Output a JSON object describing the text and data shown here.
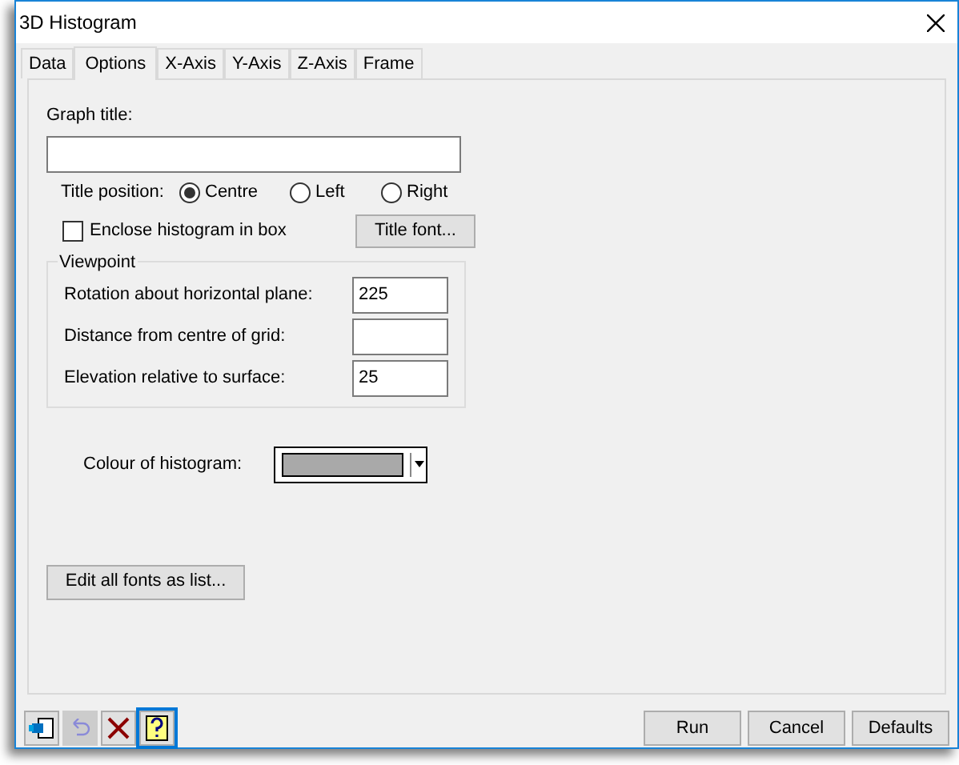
{
  "window": {
    "title": "3D Histogram"
  },
  "tabs": [
    {
      "label": "Data",
      "selected": false
    },
    {
      "label": "Options",
      "selected": true
    },
    {
      "label": "X-Axis",
      "selected": false
    },
    {
      "label": "Y-Axis",
      "selected": false
    },
    {
      "label": "Z-Axis",
      "selected": false
    },
    {
      "label": "Frame",
      "selected": false
    }
  ],
  "graph_title": {
    "label": "Graph title:"
  },
  "title_position": {
    "label": "Title position:",
    "options": [
      {
        "label": "Centre",
        "selected": true
      },
      {
        "label": "Left",
        "selected": false
      },
      {
        "label": "Right",
        "selected": false
      }
    ]
  },
  "enclose_checkbox": {
    "label": "Enclose histogram in box",
    "checked": false
  },
  "title_font_button": "Title font...",
  "viewpoint": {
    "title": "Viewpoint",
    "fields": [
      {
        "label": "Rotation about horizontal plane:",
        "value": "225"
      },
      {
        "label": "Distance from centre of grid:"
      },
      {
        "label": "Elevation relative to surface:",
        "value": "25"
      }
    ]
  },
  "colour": {
    "label": "Colour of histogram:",
    "color": "#a9a9a9"
  },
  "edit_fonts_button": "Edit all fonts as list...",
  "footer": {
    "tools": [
      {
        "kind": "exit",
        "disabled": false
      },
      {
        "kind": "undo",
        "disabled": true
      },
      {
        "kind": "clear",
        "disabled": false
      },
      {
        "kind": "help",
        "disabled": false
      }
    ],
    "buttons": [
      "Run",
      "Cancel",
      "Defaults"
    ]
  }
}
